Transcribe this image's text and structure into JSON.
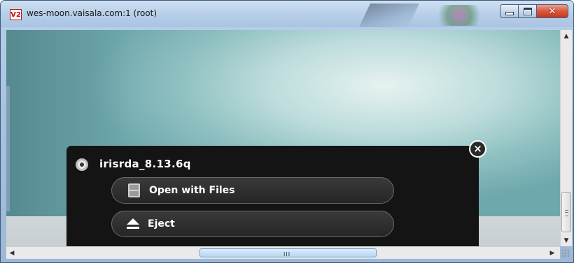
{
  "window": {
    "title": "wes-moon.vaisala.com:1 (root)",
    "app_icon_text": "V2",
    "controls": {
      "minimize": "minimize-icon",
      "maximize": "maximize-icon",
      "close": "close-icon"
    }
  },
  "notification": {
    "device_name": "irisrda_8.13.6q",
    "device_icon": "disc-icon",
    "actions": [
      {
        "label": "Open with Files",
        "icon": "files-cabinet-icon"
      },
      {
        "label": "Eject",
        "icon": "eject-icon"
      }
    ],
    "close_glyph": "×"
  },
  "scrollbars": {
    "vertical": {
      "up": "▲",
      "down": "▼"
    },
    "horizontal": {
      "left": "◀",
      "right": "▶",
      "grip": "III"
    }
  },
  "colors": {
    "titlebar": "#b7cfe9",
    "close_button": "#d9583e",
    "notification_bg": "#141414",
    "desktop": "#8fc0c1"
  }
}
